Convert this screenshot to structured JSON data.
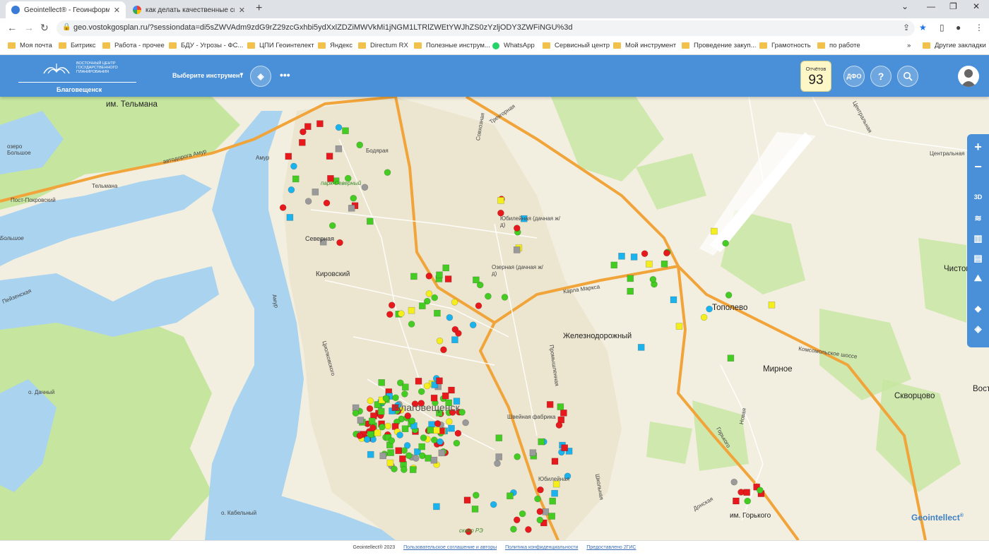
{
  "browser": {
    "tabs": [
      {
        "title": "Geointellect® - Геоинформаци",
        "active": true
      },
      {
        "title": "как делать качественные сними",
        "active": false
      }
    ],
    "url": "geo.vostokgosplan.ru/?sessiondata=di5sZWVAdm9zdG9rZ29zcGxhbi5ydXxlZDZiMWVkMi1jNGM1LTRlZWEtYWJhZS0zYzljODY3ZWFiNGU%3d",
    "bookmarks": [
      "Моя почта",
      "Битрикс",
      "Работа - прочее",
      "БДУ - Угрозы - ФС...",
      "ЦПИ Геоинтелект",
      "Яндекс",
      "Directum RX",
      "Полезные инструм...",
      "WhatsApp",
      "Сервисный центр",
      "Мой инструмент",
      "Проведение закуп...",
      "Грамотность",
      "по работе"
    ],
    "other_bookmarks": "Другие закладки"
  },
  "header": {
    "logo_text": "ВОСТОЧНЫЙ ЦЕНТР ГОСУДАРСТВЕННОГО ПЛАНИРОВАНИЯ",
    "city": "Благовещенск",
    "tool_select": "Выберите инструмент",
    "reports_label": "Отчётов",
    "reports_count": "93",
    "dfo": "ДФО",
    "help": "?"
  },
  "map": {
    "labels": {
      "telmana_big": "им. Тельмана",
      "lake_big": "озеро Большое",
      "highway_amur": "автодорога Амур",
      "amur_district": "Амур",
      "telmana_small": "Тельмана",
      "post_pokrovsky": "Пост-Покровский",
      "bolshoe": "Большое",
      "peizenskaya": "Пейзенская",
      "amur_river": "Амур",
      "park_severny": "парк Северный",
      "severnaya": "Северная",
      "kirovsky": "Кировский",
      "bodyarya": "Бодярая",
      "sovkhoznaya": "Совхозная",
      "trekhgornaya": "Трехгорная",
      "yubileynaya_dacha": "Юбилейная (дачная ж/д)",
      "ozernaya_dacha": "Озерная (дачная ж/д)",
      "karla_marksa": "Карла Маркса",
      "zheleznodorozhny": "Железнодорожный",
      "topolevo": "Тополево",
      "mirnoe": "Мирное",
      "skvortsovo": "Скворцово",
      "chistopolye": "Чистополье",
      "vost": "Вост",
      "komsomolskoe": "Комсомольское шоссе",
      "tsentralnaya": "Центральная",
      "tsentralnaya2": "Центральная",
      "dachny": "о. Дачный",
      "tsiolkovskogo": "Циолковского",
      "blagoveshchensk": "Благовещенск",
      "shveynaya": "Швейная фабрика",
      "yubileynaya": "Юбилейная",
      "shkolnaya": "Школьная",
      "kabelny": "о. Кабельный",
      "im_gorkogo": "им. Горького",
      "donskaya": "Донская",
      "gorkogo": "Горького",
      "novaya": "Новая",
      "promyshlennaya": "Промышленная",
      "park_kvartal": "сквер РЭ"
    }
  },
  "brand": "Geointellect",
  "footer": {
    "copyright": "Geointellect® 2023",
    "agreement": "Пользовательское соглашение и авторы",
    "privacy": "Политика конфиденциальности",
    "provided": "Предоставлено 2ГИС"
  },
  "colors": {
    "header_bg": "#4a90d9",
    "red": "#e8191c",
    "green": "#44cc22",
    "yellow": "#f4ee1c",
    "grey": "#9a9a9a",
    "blue": "#1ab3ee"
  }
}
